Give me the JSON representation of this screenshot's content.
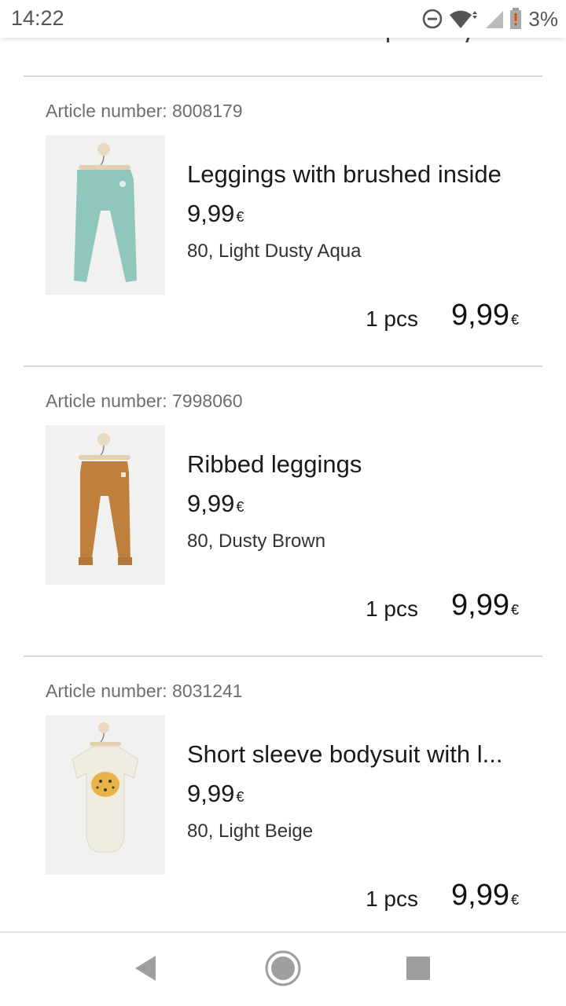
{
  "status_bar": {
    "time": "14:22",
    "battery": "3%",
    "icons": [
      "do-not-disturb-icon",
      "wifi-icon",
      "signal-icon",
      "battery-alert-icon"
    ]
  },
  "items": [
    {
      "article_label": "Article number: 8008179",
      "name": "Leggings with brushed inside",
      "unit_price": "9,99",
      "currency": "€",
      "variant": "80, Light Dusty Aqua",
      "quantity": "1 pcs",
      "total": "9,99",
      "color": "#8fc7bd"
    },
    {
      "article_label": "Article number: 7998060",
      "name": "Ribbed leggings",
      "unit_price": "9,99",
      "currency": "€",
      "variant": "80, Dusty Brown",
      "quantity": "1 pcs",
      "total": "9,99",
      "color": "#c0803d"
    },
    {
      "article_label": "Article number: 8031241",
      "name": "Short sleeve bodysuit with l...",
      "unit_price": "9,99",
      "currency": "€",
      "variant": "80, Light Beige",
      "quantity": "1 pcs",
      "total": "9,99",
      "color": "#f1ece2"
    }
  ],
  "nav": {
    "icons": [
      "back-icon",
      "home-icon",
      "recents-icon"
    ]
  }
}
